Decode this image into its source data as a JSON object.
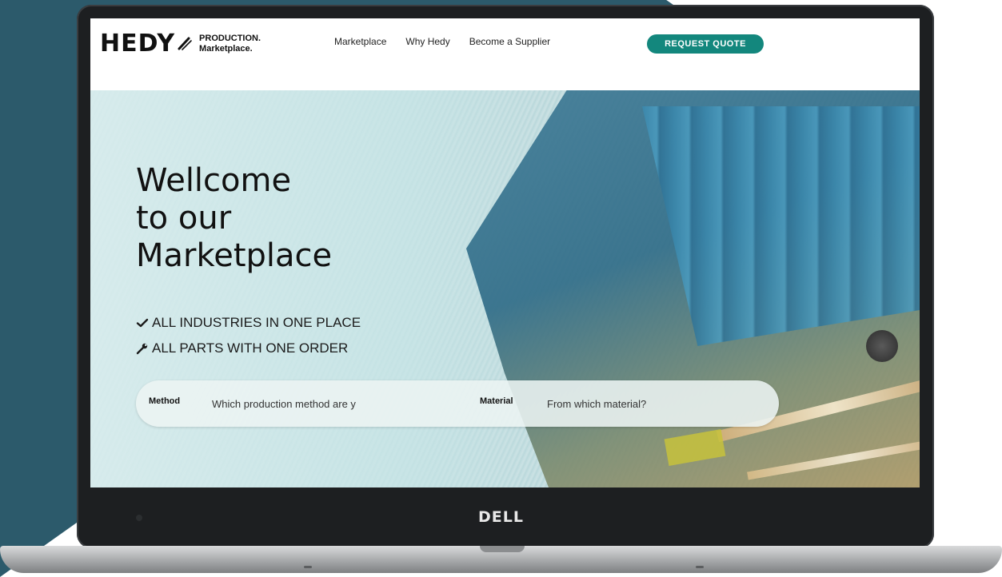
{
  "device": {
    "brand": "DELL"
  },
  "site": {
    "logo_word": "HEDY",
    "logo_sub_line1": "PRODUCTION.",
    "logo_sub_line2": "Marketplace."
  },
  "nav": {
    "items": [
      {
        "label": "Marketplace"
      },
      {
        "label": "Why Hedy"
      },
      {
        "label": "Become a Supplier"
      }
    ],
    "cta_label": "REQUEST QUOTE"
  },
  "hero": {
    "title_lines": [
      "Wellcome",
      "to our",
      "Marketplace"
    ],
    "features": [
      {
        "icon": "check-icon",
        "text": "ALL INDUSTRIES IN ONE PLACE"
      },
      {
        "icon": "wrench-icon",
        "text": "ALL PARTS WITH ONE ORDER"
      }
    ]
  },
  "search": {
    "method_label": "Method",
    "method_value": "Which production method are y",
    "material_label": "Material",
    "material_placeholder": "From which material?"
  },
  "colors": {
    "accent": "#13877d",
    "backdrop": "#2c5a6b"
  }
}
